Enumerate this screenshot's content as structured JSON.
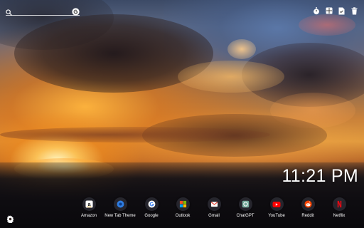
{
  "search": {
    "placeholder": "",
    "value": "",
    "icon": "search-icon",
    "engine_icon": "google-g-icon"
  },
  "toolbar": {
    "buttons": [
      {
        "icon": "stopwatch-icon"
      },
      {
        "icon": "grid-layout-icon"
      },
      {
        "icon": "notes-icon"
      },
      {
        "icon": "trash-icon"
      }
    ]
  },
  "clock": {
    "time": "11:21 PM"
  },
  "shortcuts": [
    {
      "label": "Amazon",
      "icon": "amazon-a-icon",
      "color": "#ffffff"
    },
    {
      "label": "New Tab Theme",
      "icon": "globe-icon",
      "color": "#2f7de1"
    },
    {
      "label": "Google",
      "icon": "google-g-icon",
      "color": "#ffffff"
    },
    {
      "label": "Outlook",
      "icon": "windows-tiles-icon",
      "color": "#f25022"
    },
    {
      "label": "Gmail",
      "icon": "mail-icon",
      "color": "#ea4335"
    },
    {
      "label": "ChatGPT",
      "icon": "chatgpt-icon",
      "color": "#74aa9c"
    },
    {
      "label": "YouTube",
      "icon": "play-icon",
      "color": "#ff0000"
    },
    {
      "label": "Reddit",
      "icon": "reddit-alien-icon",
      "color": "#ff4500"
    },
    {
      "label": "Netflix",
      "icon": "netflix-n-icon",
      "color": "#e50914"
    }
  ],
  "settings": {
    "icon": "gear-icon"
  }
}
